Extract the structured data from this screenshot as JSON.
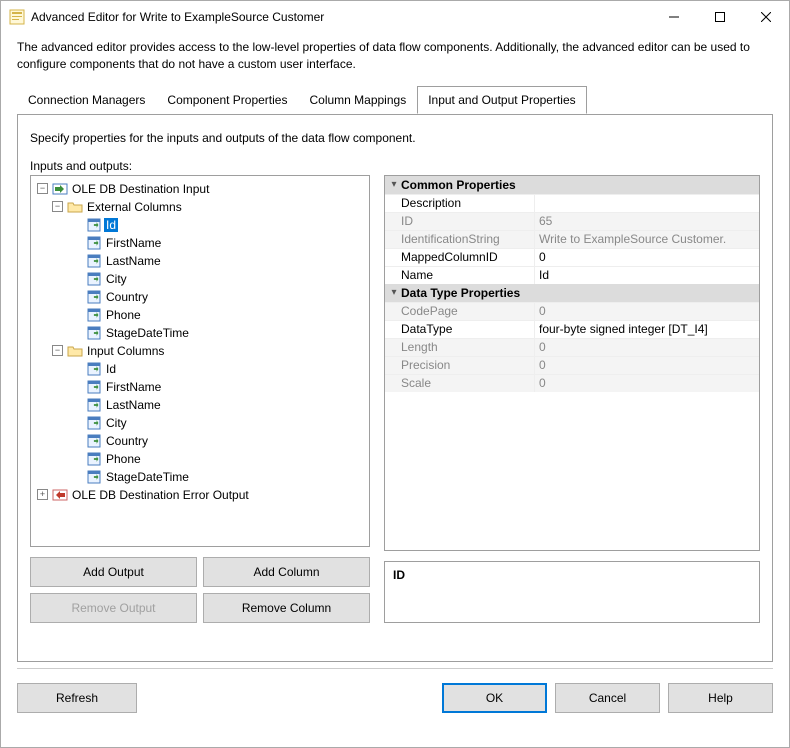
{
  "window": {
    "title": "Advanced Editor for Write to ExampleSource Customer"
  },
  "description": "The advanced editor provides access to the low-level properties of data flow components. Additionally, the advanced editor can be used to configure components that do not have a custom user interface.",
  "tabs": [
    {
      "label": "Connection Managers"
    },
    {
      "label": "Component Properties"
    },
    {
      "label": "Column Mappings"
    },
    {
      "label": "Input and Output Properties"
    }
  ],
  "active_tab_instruction": "Specify properties for the inputs and outputs of the data flow component.",
  "tree_label": "Inputs and outputs:",
  "tree": {
    "root": {
      "label": "OLE DB Destination Input",
      "external_columns": {
        "label": "External Columns",
        "items": [
          "Id",
          "FirstName",
          "LastName",
          "City",
          "Country",
          "Phone",
          "StageDateTime"
        ]
      },
      "input_columns": {
        "label": "Input Columns",
        "items": [
          "Id",
          "FirstName",
          "LastName",
          "City",
          "Country",
          "Phone",
          "StageDateTime"
        ]
      }
    },
    "error_output": {
      "label": "OLE DB Destination Error Output"
    }
  },
  "selected_node": "Id",
  "buttons": {
    "add_output": "Add Output",
    "add_column": "Add Column",
    "remove_output": "Remove Output",
    "remove_column": "Remove Column"
  },
  "propgrid": {
    "sections": {
      "common": {
        "title": "Common Properties",
        "rows": [
          {
            "key": "Description",
            "value": "",
            "readonly": false
          },
          {
            "key": "ID",
            "value": "65",
            "readonly": true
          },
          {
            "key": "IdentificationString",
            "value": "Write to ExampleSource Customer.",
            "readonly": true
          },
          {
            "key": "MappedColumnID",
            "value": "0",
            "readonly": false
          },
          {
            "key": "Name",
            "value": "Id",
            "readonly": false
          }
        ]
      },
      "datatype": {
        "title": "Data Type Properties",
        "rows": [
          {
            "key": "CodePage",
            "value": "0",
            "readonly": true
          },
          {
            "key": "DataType",
            "value": "four-byte signed integer [DT_I4]",
            "readonly": false
          },
          {
            "key": "Length",
            "value": "0",
            "readonly": true
          },
          {
            "key": "Precision",
            "value": "0",
            "readonly": true
          },
          {
            "key": "Scale",
            "value": "0",
            "readonly": true
          }
        ]
      }
    },
    "help_label": "ID"
  },
  "dialog_buttons": {
    "refresh": "Refresh",
    "ok": "OK",
    "cancel": "Cancel",
    "help": "Help"
  }
}
